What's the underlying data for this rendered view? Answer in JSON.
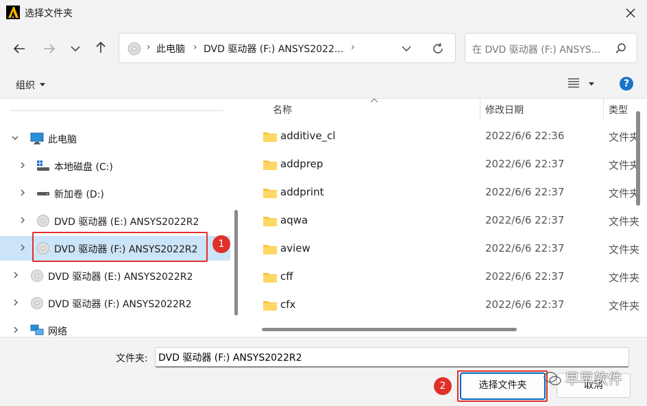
{
  "window": {
    "title": "选择文件夹",
    "close_icon": "close-icon",
    "app_icon": "ansys-logo"
  },
  "navigation": {
    "back_icon": "arrow-left-icon",
    "forward_icon": "arrow-right-icon",
    "recent_icon": "chevron-down-icon",
    "up_icon": "arrow-up-icon",
    "address": {
      "segments": [
        "此电脑",
        "DVD 驱动器 (F:) ANSYS2022..."
      ],
      "drop_icon": "chevron-down-icon",
      "refresh_icon": "refresh-icon"
    },
    "search": {
      "placeholder": "在 DVD 驱动器 (F:) ANSYS..."
    }
  },
  "command_bar": {
    "organize": "组织",
    "view_icon": "list-view-icon",
    "help": "?"
  },
  "nav_tree": [
    {
      "label": "此电脑",
      "icon": "monitor-icon",
      "expanded": true,
      "level": 0
    },
    {
      "label": "本地磁盘 (C:)",
      "icon": "windows-drive-icon",
      "level": 1
    },
    {
      "label": "新加卷 (D:)",
      "icon": "drive-icon",
      "level": 1
    },
    {
      "label": "DVD 驱动器 (E:) ANSYS2022R2",
      "icon": "disc-icon",
      "level": 1
    },
    {
      "label": "DVD 驱动器 (F:) ANSYS2022R2",
      "icon": "disc-icon",
      "level": 1,
      "selected": true
    },
    {
      "label": "DVD 驱动器 (E:) ANSYS2022R2",
      "icon": "disc-icon",
      "level": 0
    },
    {
      "label": "DVD 驱动器 (F:) ANSYS2022R2",
      "icon": "disc-icon",
      "level": 0
    },
    {
      "label": "网络",
      "icon": "network-icon",
      "level": 0
    }
  ],
  "file_list": {
    "columns": {
      "name": "名称",
      "modified": "修改日期",
      "type": "类型"
    },
    "rows": [
      {
        "name": "additive_cl",
        "modified": "2022/6/6 22:36",
        "type": "文件夹"
      },
      {
        "name": "addprep",
        "modified": "2022/6/6 22:37",
        "type": "文件夹"
      },
      {
        "name": "addprint",
        "modified": "2022/6/6 22:37",
        "type": "文件夹"
      },
      {
        "name": "aqwa",
        "modified": "2022/6/6 22:37",
        "type": "文件夹"
      },
      {
        "name": "aview",
        "modified": "2022/6/6 22:37",
        "type": "文件夹"
      },
      {
        "name": "cff",
        "modified": "2022/6/6 22:37",
        "type": "文件夹"
      },
      {
        "name": "cfx",
        "modified": "2022/6/6 22:37",
        "type": "文件夹"
      }
    ]
  },
  "footer": {
    "folder_label": "文件夹:",
    "folder_value": "DVD 驱动器 (F:) ANSYS2022R2",
    "select_button": "选择文件夹",
    "cancel_button": "取消"
  },
  "annotations": {
    "badge1": "1",
    "badge2": "2",
    "highlight_color": "#e0302a"
  },
  "watermark": "早早软件",
  "colors": {
    "selection": "#cce4f7",
    "accent": "#0067c0",
    "folder": "#f4c542",
    "chrome": "#f3f3f3"
  }
}
